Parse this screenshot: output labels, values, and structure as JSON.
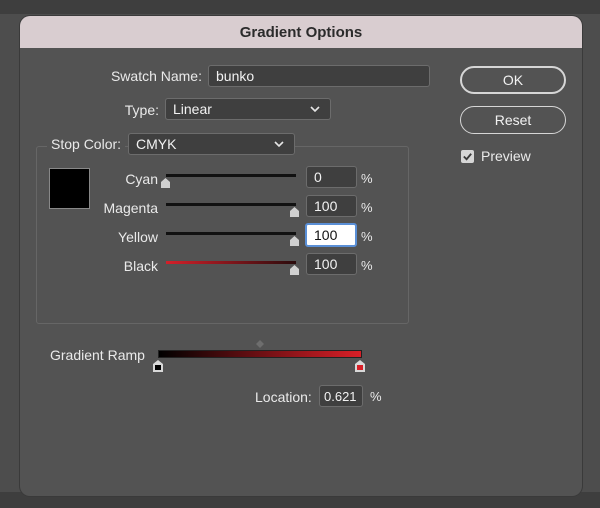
{
  "dialog": {
    "title": "Gradient Options"
  },
  "swatch": {
    "label": "Swatch Name:",
    "value": "bunko"
  },
  "type": {
    "label": "Type:",
    "value": "Linear"
  },
  "stop_color": {
    "label": "Stop Color:",
    "value": "CMYK"
  },
  "sliders": [
    {
      "label": "Cyan",
      "value": "0",
      "unit": "%",
      "level": 0
    },
    {
      "label": "Magenta",
      "value": "100",
      "unit": "%",
      "level": 1
    },
    {
      "label": "Yellow",
      "value": "100",
      "unit": "%",
      "level": 1
    },
    {
      "label": "Black",
      "value": "100",
      "unit": "%",
      "level": 1
    }
  ],
  "ramp": {
    "label": "Gradient Ramp",
    "start_color": "#000000",
    "end_color": "#d91f27"
  },
  "location": {
    "label": "Location:",
    "value": "0.621",
    "unit": "%"
  },
  "buttons": {
    "ok": "OK",
    "cancel": "Reset"
  },
  "preview": {
    "label": "Preview",
    "checked": true
  },
  "colors": {
    "title_bar": "#d9cdd0",
    "dialog_bg": "#535353",
    "accent": "#5a8fd6"
  }
}
